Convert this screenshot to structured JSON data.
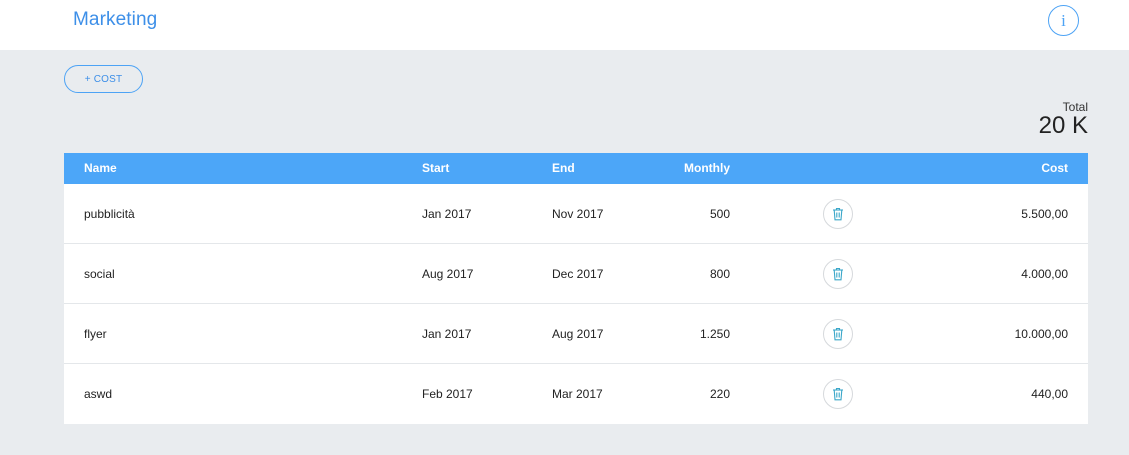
{
  "header": {
    "title": "Marketing",
    "info_icon": "info-icon",
    "info_glyph": "i"
  },
  "toolbar": {
    "add_cost_label": "+ COST"
  },
  "summary": {
    "total_label": "Total",
    "total_value": "20 K"
  },
  "table": {
    "columns": {
      "name": "Name",
      "start": "Start",
      "end": "End",
      "monthly": "Monthly",
      "cost": "Cost"
    },
    "rows": [
      {
        "name": "pubblicità",
        "start": "Jan 2017",
        "end": "Nov 2017",
        "monthly": "500",
        "cost": "5.500,00"
      },
      {
        "name": "social",
        "start": "Aug 2017",
        "end": "Dec 2017",
        "monthly": "800",
        "cost": "4.000,00"
      },
      {
        "name": "flyer",
        "start": "Jan 2017",
        "end": "Aug 2017",
        "monthly": "1.250",
        "cost": "10.000,00"
      },
      {
        "name": "aswd",
        "start": "Feb 2017",
        "end": "Mar 2017",
        "monthly": "220",
        "cost": "440,00"
      }
    ],
    "row_action_icon": "trash-icon"
  },
  "colors": {
    "accent": "#3d8fe8",
    "header_bg": "#4ca6f8",
    "page_bg": "#e9ecef",
    "trash_icon": "#3aa7c9"
  }
}
